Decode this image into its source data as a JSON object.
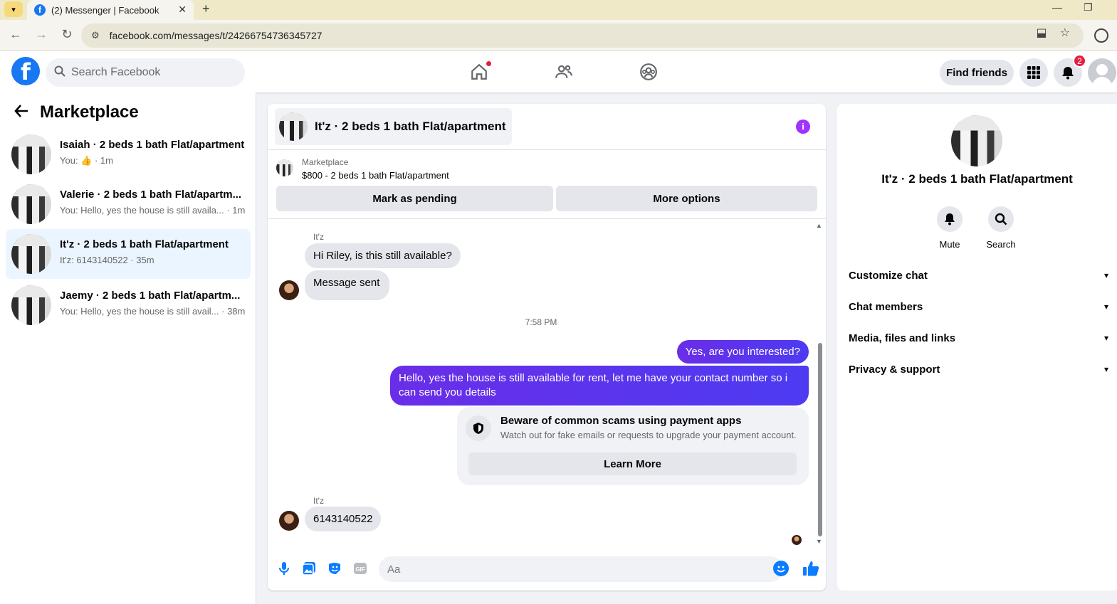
{
  "browser": {
    "tab_title": "(2) Messenger | Facebook",
    "tab_favicon": "f",
    "url": "facebook.com/messages/t/24266754736345727",
    "tab_close": "✕",
    "new_tab": "+",
    "minimize": "—",
    "restore": "❐"
  },
  "header": {
    "logo": "f",
    "search_placeholder": "Search Facebook",
    "find_friends": "Find friends",
    "notification_count": "2"
  },
  "sidebar": {
    "title": "Marketplace",
    "conversations": [
      {
        "name": "Isaiah · 2 beds 1 bath Flat/apartment",
        "preview_prefix": "You: ",
        "preview_suffix": " · 1m",
        "active": false
      },
      {
        "name": "Valerie · 2 beds 1 bath Flat/apartm...",
        "preview": "You: Hello, yes the house is still availa... · 1m",
        "active": false
      },
      {
        "name": "It'z · 2 beds 1 bath Flat/apartment",
        "preview": "It'z: 6143140522 · 35m",
        "active": true
      },
      {
        "name": "Jaemy · 2 beds 1 bath Flat/apartm...",
        "preview": "You: Hello, yes the house is still avail... · 38m",
        "active": false
      }
    ]
  },
  "chat": {
    "title": "It'z · 2 beds 1 bath Flat/apartment",
    "marketplace_label": "Marketplace",
    "listing": "$800 - 2 beds 1 bath Flat/apartment",
    "mark_pending": "Mark as pending",
    "more_options": "More options",
    "messages": {
      "sender1": "It'z",
      "in1": "Hi Riley, is this still available?",
      "in2": "Message sent",
      "time": "7:58 PM",
      "out1": "Yes, are you interested?",
      "out2": "Hello, yes the house is still available for rent, let me have your contact number so i can send you details",
      "scam_title": "Beware of common scams using payment apps",
      "scam_desc": "Watch out for fake emails or requests to upgrade your payment account.",
      "learn_more": "Learn More",
      "sender2": "It'z",
      "in3": "6143140522"
    },
    "input_placeholder": "Aa",
    "accent_color": "#5b34f5"
  },
  "info_panel": {
    "title": "It'z · 2 beds 1 bath Flat/apartment",
    "mute": "Mute",
    "search": "Search",
    "sections": [
      "Customize chat",
      "Chat members",
      "Media, files and links",
      "Privacy & support"
    ]
  },
  "icons": {
    "home": "home-icon",
    "friends": "friends-icon",
    "groups": "groups-icon",
    "menu": "grid-menu-icon",
    "bell": "bell-icon"
  }
}
